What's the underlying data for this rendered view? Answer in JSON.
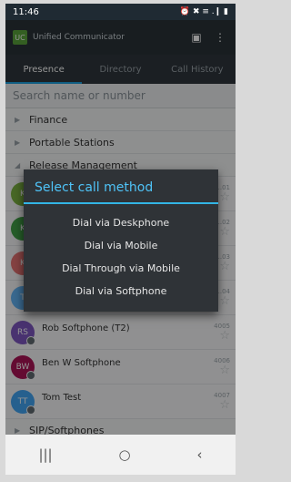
{
  "status": {
    "time": "11:46",
    "icons": "⏰ ✖ ≡ .❙ ▮"
  },
  "app": {
    "logo_text": "UC",
    "title": "Unified Communicator"
  },
  "tabs": [
    {
      "label": "Presence"
    },
    {
      "label": "Directory"
    },
    {
      "label": "Call History"
    }
  ],
  "search": {
    "placeholder": "Search name or number"
  },
  "groups": {
    "finance": "Finance",
    "portable": "Portable Stations",
    "release": "Release Management",
    "sip": "SIP/Softphones"
  },
  "contacts": [
    {
      "initials": "K",
      "name": "",
      "ext": "...01",
      "color": "#7cb342"
    },
    {
      "initials": "K",
      "name": "",
      "ext": "...02",
      "color": "#43a047"
    },
    {
      "initials": "K",
      "name": "",
      "ext": "...03",
      "color": "#e57373"
    },
    {
      "initials": "T",
      "name": "",
      "ext": "...04",
      "color": "#64b5f6"
    },
    {
      "initials": "RS",
      "name": "Rob Softphone (T2)",
      "ext": "4005",
      "color": "#7e57c2"
    },
    {
      "initials": "BW",
      "name": "Ben W Softphone",
      "ext": "4006",
      "color": "#ad1457"
    },
    {
      "initials": "TT",
      "name": "Tom Test",
      "ext": "4007",
      "color": "#42a5f5"
    }
  ],
  "dialog": {
    "title": "Select call method",
    "options": [
      "Dial via Deskphone",
      "Dial via Mobile",
      "Dial Through via Mobile",
      "Dial via Softphone"
    ]
  },
  "nav": {
    "recents": "|||",
    "home": "○",
    "back": "‹"
  },
  "colors": {
    "accent": "#33b5e5",
    "dialog_bg": "#2f3337",
    "appbar": "#2a3238"
  }
}
